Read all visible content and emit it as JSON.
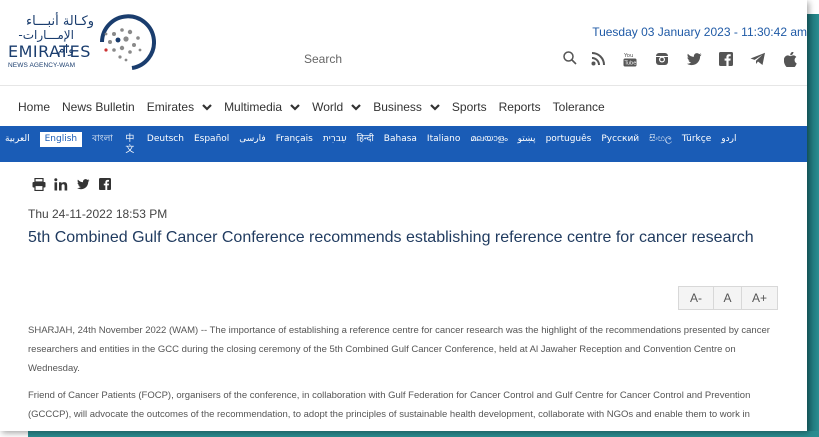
{
  "logo": {
    "arabic_line1": "وكـالة أنبـــاء",
    "arabic_line2": "الإمـــارات-وام",
    "english": "EMIRATES",
    "subline": "NEWS AGENCY-WAM"
  },
  "header": {
    "datetime": "Tuesday 03 January 2023 - 11:30:42 am",
    "search_placeholder": "Search"
  },
  "social": [
    {
      "name": "rss-icon"
    },
    {
      "name": "youtube-icon"
    },
    {
      "name": "instagram-icon"
    },
    {
      "name": "twitter-icon"
    },
    {
      "name": "facebook-icon"
    },
    {
      "name": "telegram-icon"
    },
    {
      "name": "apple-icon"
    }
  ],
  "nav": {
    "items": [
      {
        "label": "Home",
        "dropdown": false
      },
      {
        "label": "News Bulletin",
        "dropdown": false
      },
      {
        "label": "Emirates",
        "dropdown": true
      },
      {
        "label": "Multimedia",
        "dropdown": true
      },
      {
        "label": "World",
        "dropdown": true
      },
      {
        "label": "Business",
        "dropdown": true
      },
      {
        "label": "Sports",
        "dropdown": false
      },
      {
        "label": "Reports",
        "dropdown": false
      },
      {
        "label": "Tolerance",
        "dropdown": false
      }
    ]
  },
  "languages": [
    "العربية",
    "English",
    "বাংলা",
    "中文",
    "Deutsch",
    "Español",
    "فارسی",
    "Français",
    "עִברִית",
    "हिन्दी",
    "Bahasa",
    "Italiano",
    "മലയാളം",
    "پښتو",
    "português",
    "Русский",
    "සිංහල",
    "Türkçe",
    "اردو"
  ],
  "active_language": "English",
  "article": {
    "date": "Thu 24-11-2022 18:53 PM",
    "title": "5th Combined Gulf Cancer Conference recommends establishing reference centre for cancer research",
    "font_controls": [
      "A-",
      "A",
      "A+"
    ],
    "paragraph1": "SHARJAH, 24th November 2022 (WAM) -- The importance of establishing a reference centre for cancer research was the highlight of the recommendations presented by cancer researchers and entities in the GCC during the closing ceremony of the 5th Combined Gulf Cancer Conference, held at Al Jawaher Reception and Convention Centre on Wednesday.",
    "paragraph2": "Friend of Cancer Patients (FOCP), organisers of the conference, in collaboration with Gulf Federation for Cancer Control and Gulf Centre for Cancer Control and Prevention (GCCCP), will advocate the outcomes of the recommendation, to adopt the principles of sustainable health development, collaborate with NGOs and enable them to work in"
  },
  "colors": {
    "brand_blue": "#1a5cb6",
    "title_navy": "#1f3a5f",
    "backdrop_teal": "#2a8d90"
  }
}
